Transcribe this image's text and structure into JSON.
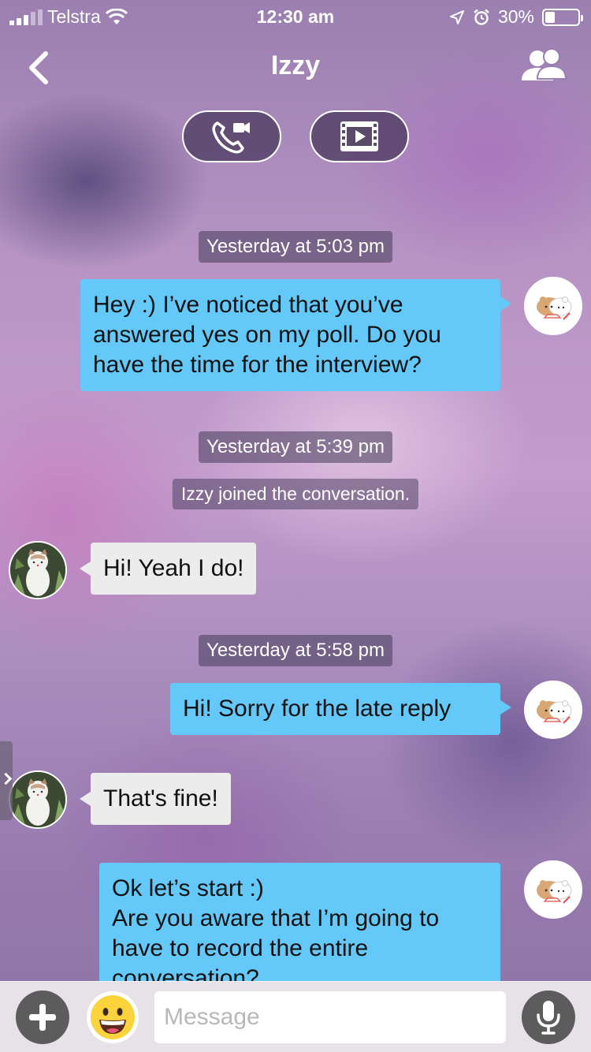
{
  "status_bar": {
    "carrier": "Telstra",
    "time": "12:30 am",
    "battery": "30%",
    "battery_level": 0.3,
    "icons": [
      "signal-icon",
      "wifi-icon",
      "location-icon",
      "alarm-icon",
      "battery-icon"
    ]
  },
  "header": {
    "title": "Izzy",
    "back_icon": "chevron-left-icon",
    "members_icon": "members-icon"
  },
  "call_buttons": [
    {
      "name": "voice-video-call",
      "icon": "phone-video-icon"
    },
    {
      "name": "screening-room",
      "icon": "film-play-icon"
    }
  ],
  "messages": [
    {
      "type": "timestamp",
      "text": "Yesterday at 5:03 pm"
    },
    {
      "type": "outgoing",
      "lines": [
        "Hey :) I’ve noticed that you’ve",
        "answered yes on my poll. Do you",
        "have the time for the interview?"
      ]
    },
    {
      "type": "timestamp",
      "text": "Yesterday at 5:39 pm"
    },
    {
      "type": "system",
      "text": "Izzy joined the conversation."
    },
    {
      "type": "incoming",
      "lines": [
        "Hi! Yeah I do!"
      ]
    },
    {
      "type": "timestamp",
      "text": "Yesterday at 5:58 pm"
    },
    {
      "type": "outgoing",
      "lines": [
        "Hi! Sorry for the late reply"
      ]
    },
    {
      "type": "incoming",
      "lines": [
        "That's fine!"
      ]
    },
    {
      "type": "outgoing",
      "lines": [
        "Ok let’s start :)",
        "Are you aware that I’m going to",
        "have to record the entire",
        "conversation?"
      ]
    }
  ],
  "input_bar": {
    "placeholder": "Message",
    "value": "",
    "plus_icon": "plus-icon",
    "emoji_icon": "grinning-face-icon",
    "mic_icon": "microphone-icon"
  },
  "colors": {
    "outgoing_bubble": "#64c8f8",
    "incoming_bubble": "#ececec",
    "timestamp_bg": "#463c5a"
  }
}
